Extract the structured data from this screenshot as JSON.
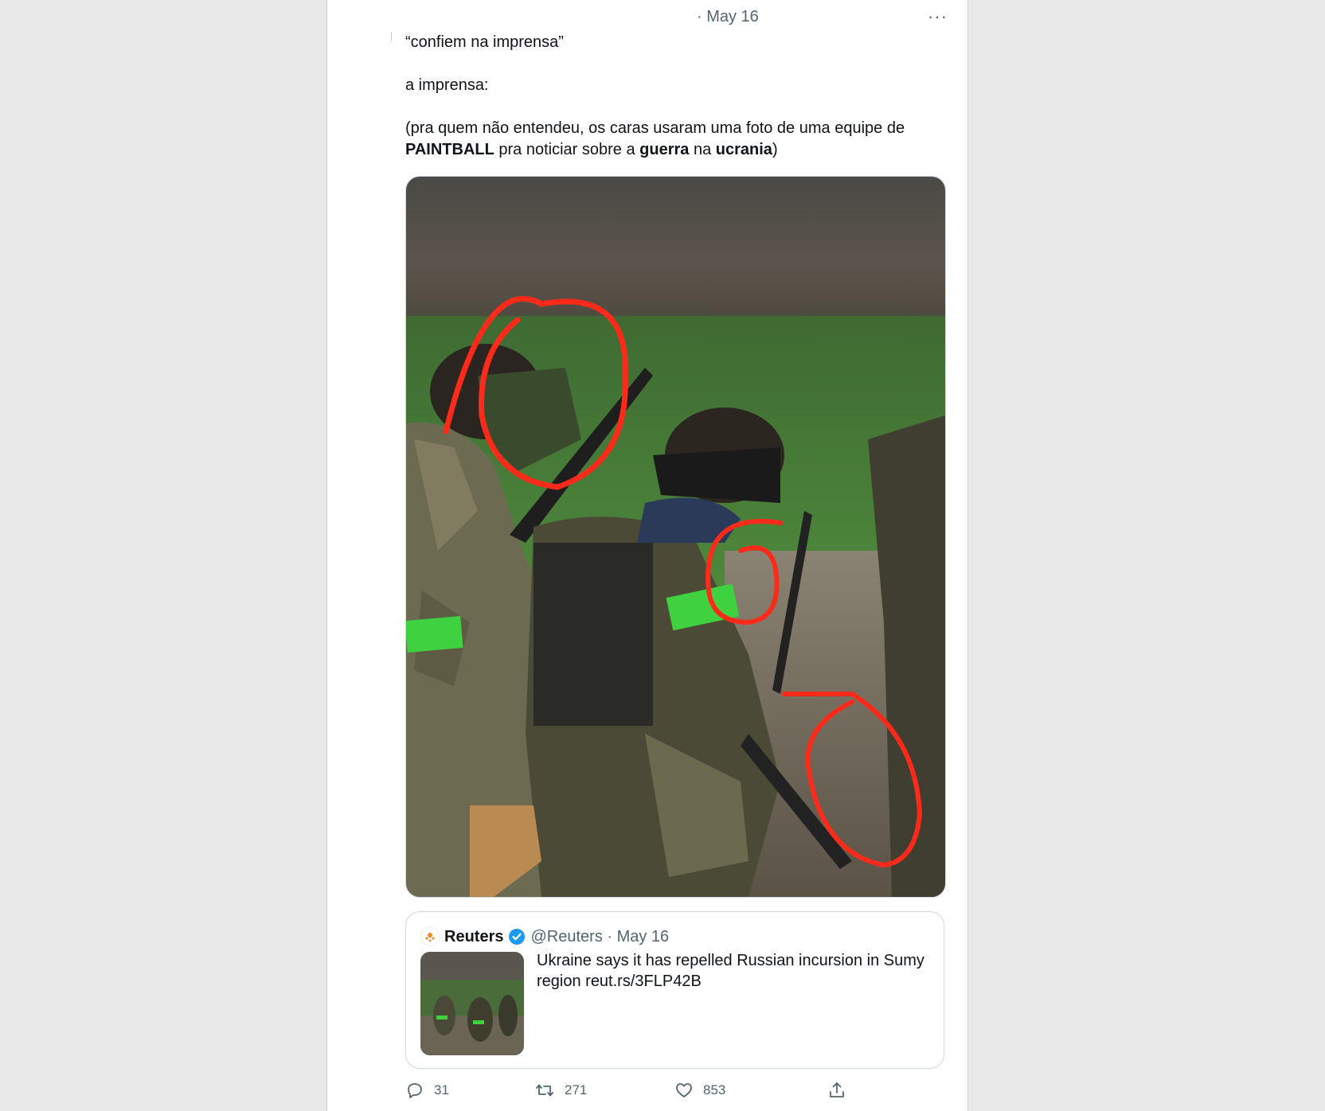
{
  "tweet": {
    "date": "· May 16",
    "more_label": "···",
    "line1": "“confiem na imprensa”",
    "line2": "a imprensa:",
    "line3_part1": "(pra quem não entendeu, os caras usaram uma foto de uma equipe de ",
    "line3_bold1": "PAINTBALL",
    "line3_part2": " pra noticiar sobre a ",
    "line3_bold2": "guerra",
    "line3_part3": " na ",
    "line3_bold3": "ucrania",
    "line3_part4": ")"
  },
  "quoted_tweet": {
    "name": "Reuters",
    "handle": "@Reuters · May 16",
    "text": "Ukraine says it has repelled Russian incursion in Sumy region reut.rs/3FLP42B"
  },
  "actions": {
    "reply_count": "31",
    "retweet_count": "271",
    "like_count": "853"
  },
  "colors": {
    "accent": "#1d9bf0",
    "annotation_red": "#ff2a1a",
    "armband_green": "#3fd13f"
  },
  "icons": {
    "verified": "verified-badge-icon",
    "reply": "reply-icon",
    "retweet": "retweet-icon",
    "like": "heart-icon",
    "share": "share-icon",
    "more": "more-horizontal-icon"
  }
}
